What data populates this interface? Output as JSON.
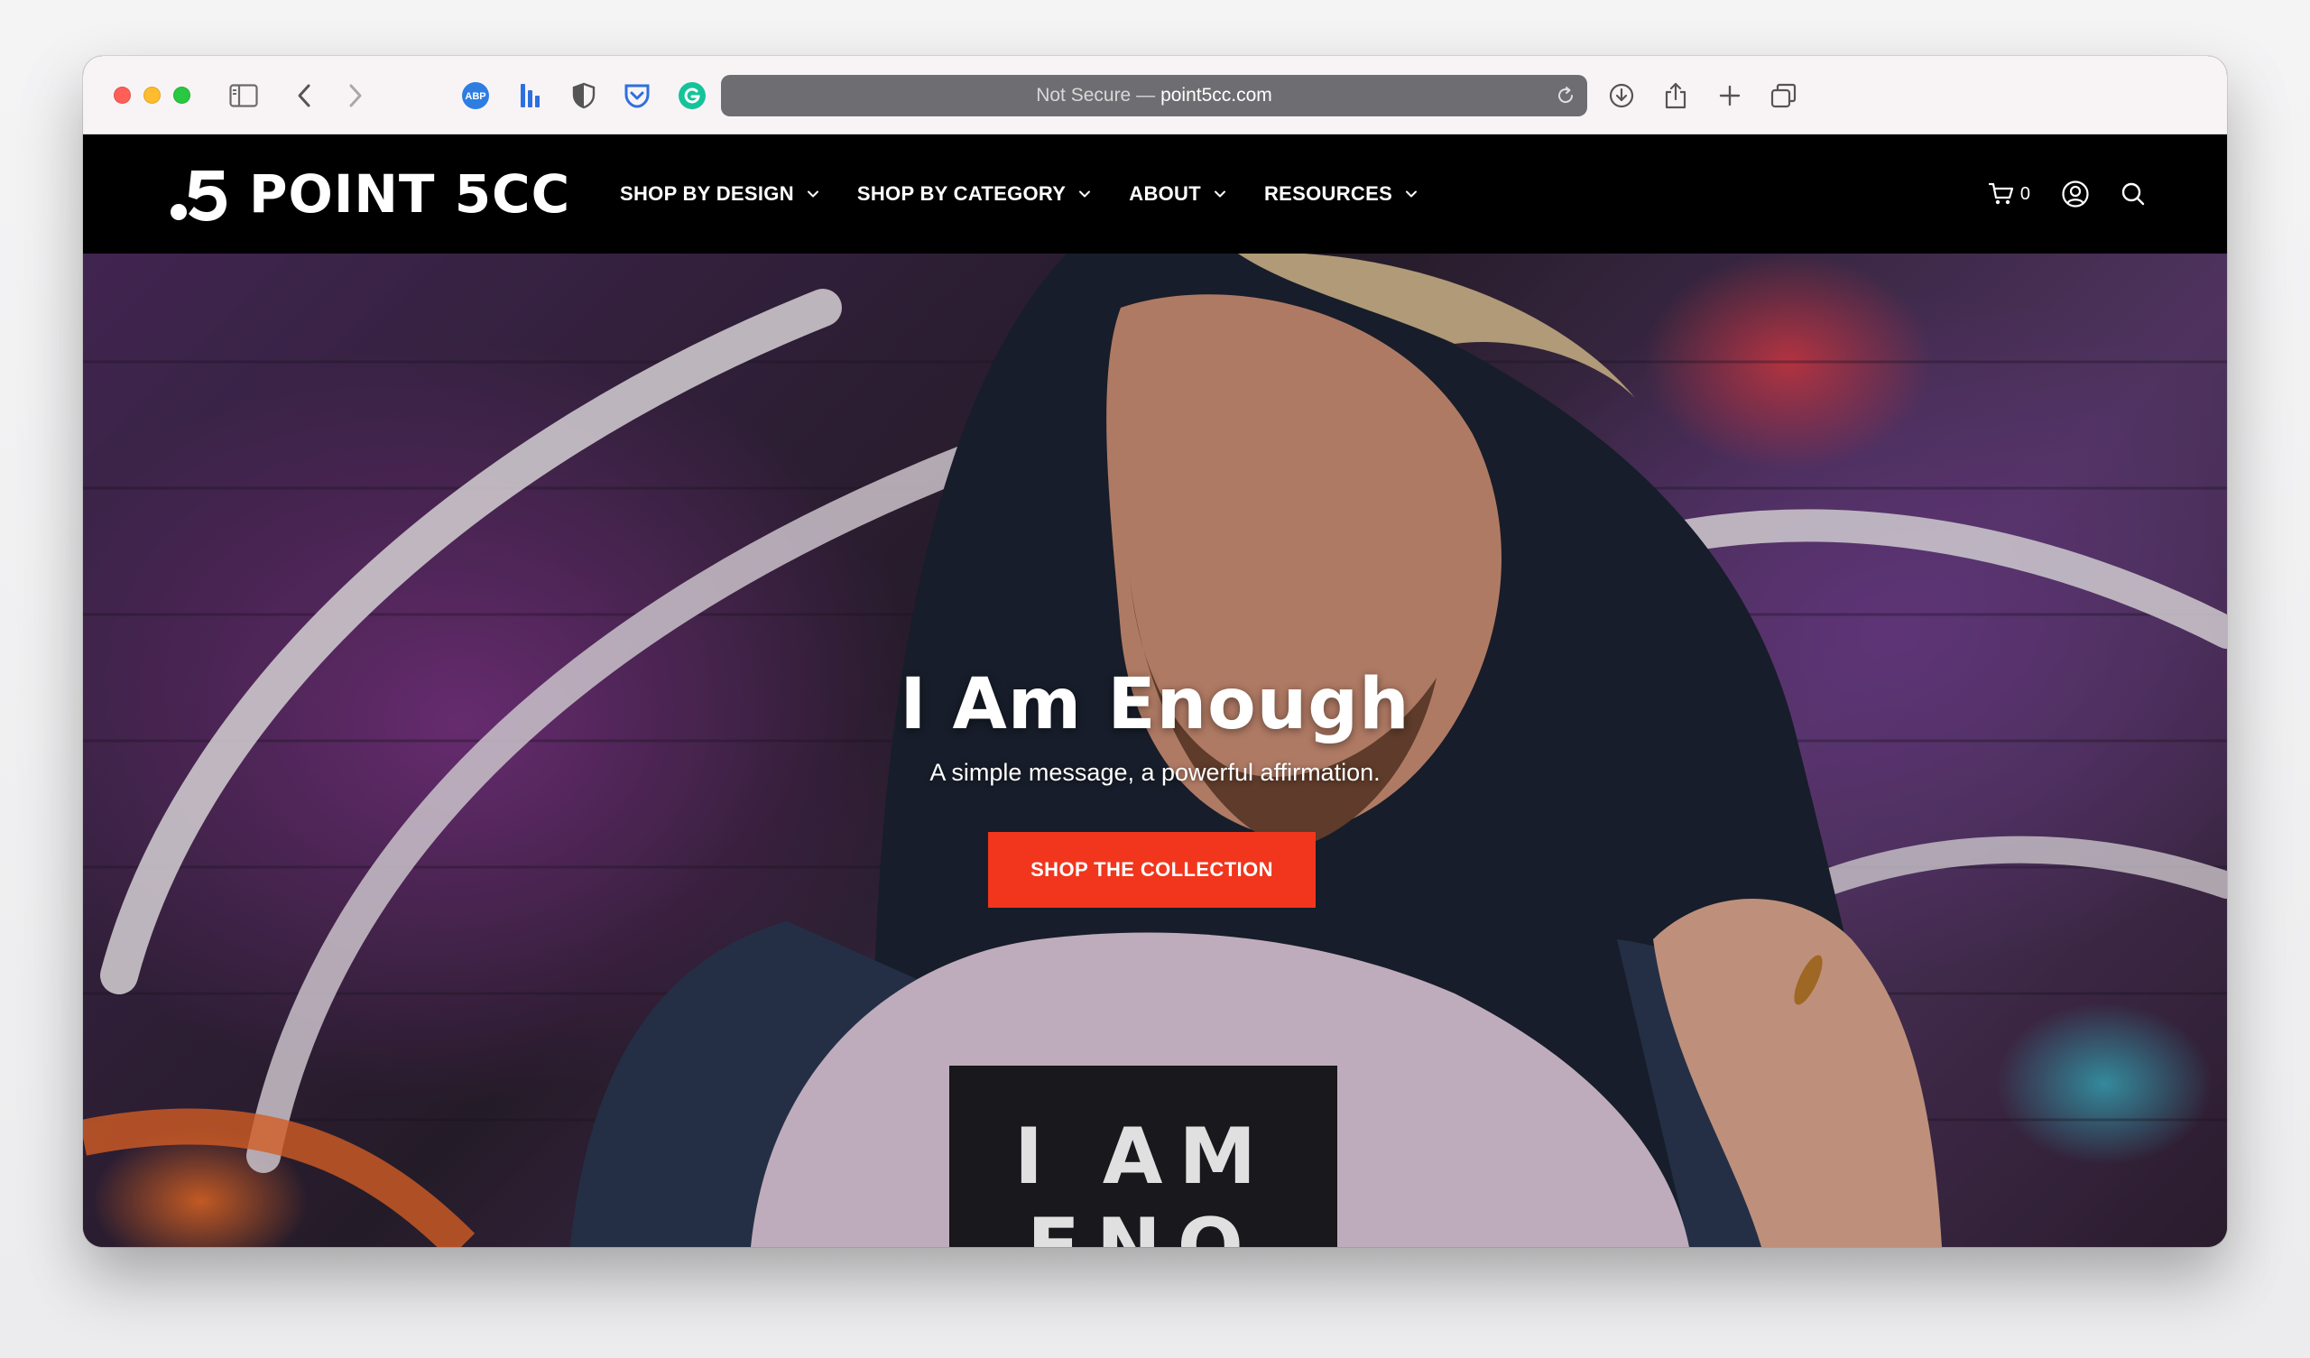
{
  "browser": {
    "url_prefix": "Not Secure —",
    "url_host": "point5cc.com",
    "extensions": [
      "abp-icon",
      "bars-extension-icon",
      "shield-icon",
      "pocket-icon",
      "grammarly-icon"
    ]
  },
  "site": {
    "logo_text": "POINT 5CC",
    "nav": [
      {
        "label": "SHOP BY DESIGN"
      },
      {
        "label": "SHOP BY CATEGORY"
      },
      {
        "label": "ABOUT"
      },
      {
        "label": "RESOURCES"
      }
    ],
    "cart_count": "0"
  },
  "hero": {
    "title": "I Am Enough",
    "subtitle": "A simple message, a powerful affirmation.",
    "cta_label": "SHOP THE COLLECTION",
    "shirt_text_line1": "I AM",
    "shirt_text_line2": "ENO"
  },
  "colors": {
    "accent": "#f1361d",
    "header_bg": "#000000",
    "urlbar_bg": "#6e6e72"
  }
}
